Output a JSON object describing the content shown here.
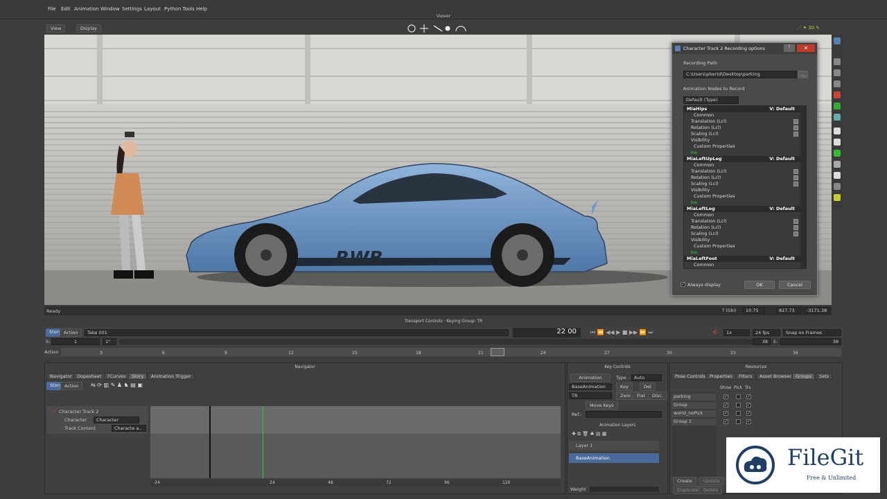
{
  "menu": [
    "File",
    "Edit",
    "Animation",
    "Window",
    "Settings",
    "Layout",
    "Python Tools",
    "Help"
  ],
  "viewer": {
    "title": "Viewer",
    "view_btn": "View",
    "display_btn": "Display"
  },
  "status": {
    "ready": "Ready",
    "t_label": "T (Gbl)",
    "x_val": "10.75",
    "y_val": "827.73",
    "z_val": "-3171.38"
  },
  "car_text": "RWB",
  "dialog": {
    "title": "Character Track 2 Recording options",
    "path_label": "Recording Path",
    "path_value": "C:\\Users\\pbertd\\Desktop\\parking",
    "path_browse": "...",
    "nodes_label": "Animation Nodes to Record",
    "combo_value": "Default (Type)",
    "always_display": "Always display",
    "ok": "OK",
    "cancel": "Cancel",
    "nodes": [
      {
        "name": "MiaHips",
        "v": "V: Default"
      },
      {
        "name": "MiaLeftUpLeg",
        "v": "V: Default"
      },
      {
        "name": "MiaLeftLeg",
        "v": "V: Default"
      },
      {
        "name": "MiaLeftFoot",
        "v": "V: Default"
      }
    ],
    "common": "Common",
    "translation": "Translation (Lcl)",
    "rotation": "Rotation (Lcl)",
    "scaling": "Scaling (Lcl)",
    "visibility": "Visibility",
    "custom": "Custom Properties",
    "kw": "kw"
  },
  "transport": {
    "title": "Transport Controls  ·  Keying Group: TR",
    "story": "Story",
    "action": "Action",
    "take": "Take 001",
    "frame_big": "22",
    "frame_small": "00",
    "speed": "1x",
    "fps": "24 fps",
    "snap": "Snap on Frames",
    "s_label": "S:",
    "s_val": "1",
    "s_val2": "1\"",
    "e_label": "E:",
    "e_val": "38",
    "e_val2": "38",
    "action_label": "Action",
    "ticks": [
      "3",
      "6",
      "9",
      "12",
      "15",
      "18",
      "21",
      "24",
      "27",
      "30",
      "33",
      "36"
    ]
  },
  "navigator": {
    "title": "Navigator",
    "tabs": [
      "Navigator",
      "Dopesheet",
      "FCurves",
      "Story",
      "Animation Trigger"
    ],
    "story": "Story",
    "action": "Action",
    "track": "Character Track 2",
    "character_label": "Character",
    "character_value": "Character",
    "track_content_label": "Track Content",
    "track_content_value": "Characte a..",
    "ruler": [
      "24",
      "24",
      "48",
      "72",
      "96",
      "120"
    ]
  },
  "key_controls": {
    "title": "Key Controls",
    "animation": "Animation",
    "type_label": "Type :",
    "type_value": "Auto",
    "layer_value": "BaseAnimation",
    "key": "Key",
    "del": "Del",
    "group": "TR",
    "zero": "Zero",
    "flat": "Flat",
    "disc": "Disc.",
    "move_keys": "Move Keys",
    "ref_label": "Ref.:",
    "layers_title": "Animation Layers",
    "layer1": "Layer 1",
    "base": "BaseAnimation",
    "weight": "Weight"
  },
  "resources": {
    "title": "Resources",
    "tabs": [
      "Pose Controls",
      "Properties",
      "Filters",
      "Asset Browser",
      "Groups",
      "Sets"
    ],
    "cols": [
      "Show",
      "Pick",
      "Trs"
    ],
    "groups": [
      "parking",
      "Group",
      "world_noPick",
      "Group 1"
    ],
    "create": "Create",
    "update": "Update",
    "duplicate": "Duplicate",
    "delete": "Delete"
  },
  "watermark": {
    "brand": "FileGit",
    "tagline": "Free & Unlimited"
  },
  "colors": {
    "accent": "#4a6a9c",
    "car": "#6f9acb",
    "highlight": "#2ecc40"
  }
}
